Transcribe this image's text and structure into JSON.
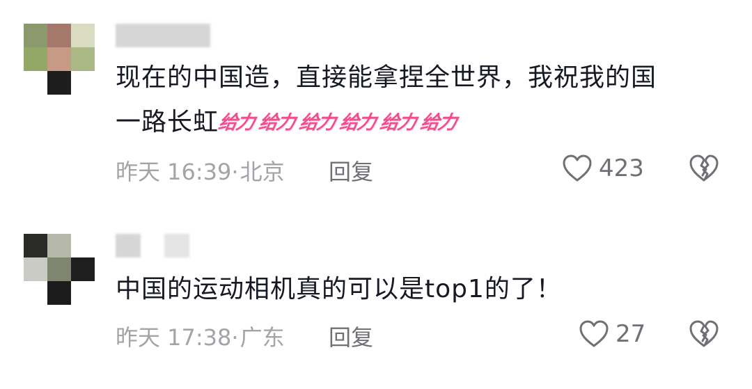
{
  "colors": {
    "text": "#161823",
    "meta": "#a3a3a8",
    "action": "#6f7075",
    "emoji": "#f24d8f"
  },
  "comments": [
    {
      "avatar_pixels": [
        "#8a9a6c",
        "#a4786a",
        "#d9dcc0",
        "#93a866",
        "#c79a86",
        "#a9b885",
        "#ffffff",
        "#1c1d1c",
        "#ffffff"
      ],
      "text_line1": "现在的中国造，直接能拿捏全世界，我祝我的国",
      "text_line2": "一路长虹",
      "emojis": [
        "给力",
        "给力",
        "给力",
        "给力",
        "给力",
        "给力"
      ],
      "time": "昨天 16:39·",
      "location": "北京",
      "reply_label": "回复",
      "likes": "423",
      "like_icon": "heart-outline-icon",
      "dislike_icon": "broken-heart-icon"
    },
    {
      "avatar_pixels": [
        "#2a2a28",
        "#b6b9a9",
        "#ffffff",
        "#c9cbc4",
        "#7e8670",
        "#1d1e1d",
        "#ffffff",
        "#1b1b1b",
        "#ffffff"
      ],
      "text_line1": "中国的运动相机真的可以是top1的了！",
      "time": "昨天 17:38·",
      "location": "广东",
      "reply_label": "回复",
      "likes": "27",
      "like_icon": "heart-outline-icon",
      "dislike_icon": "broken-heart-icon"
    }
  ]
}
